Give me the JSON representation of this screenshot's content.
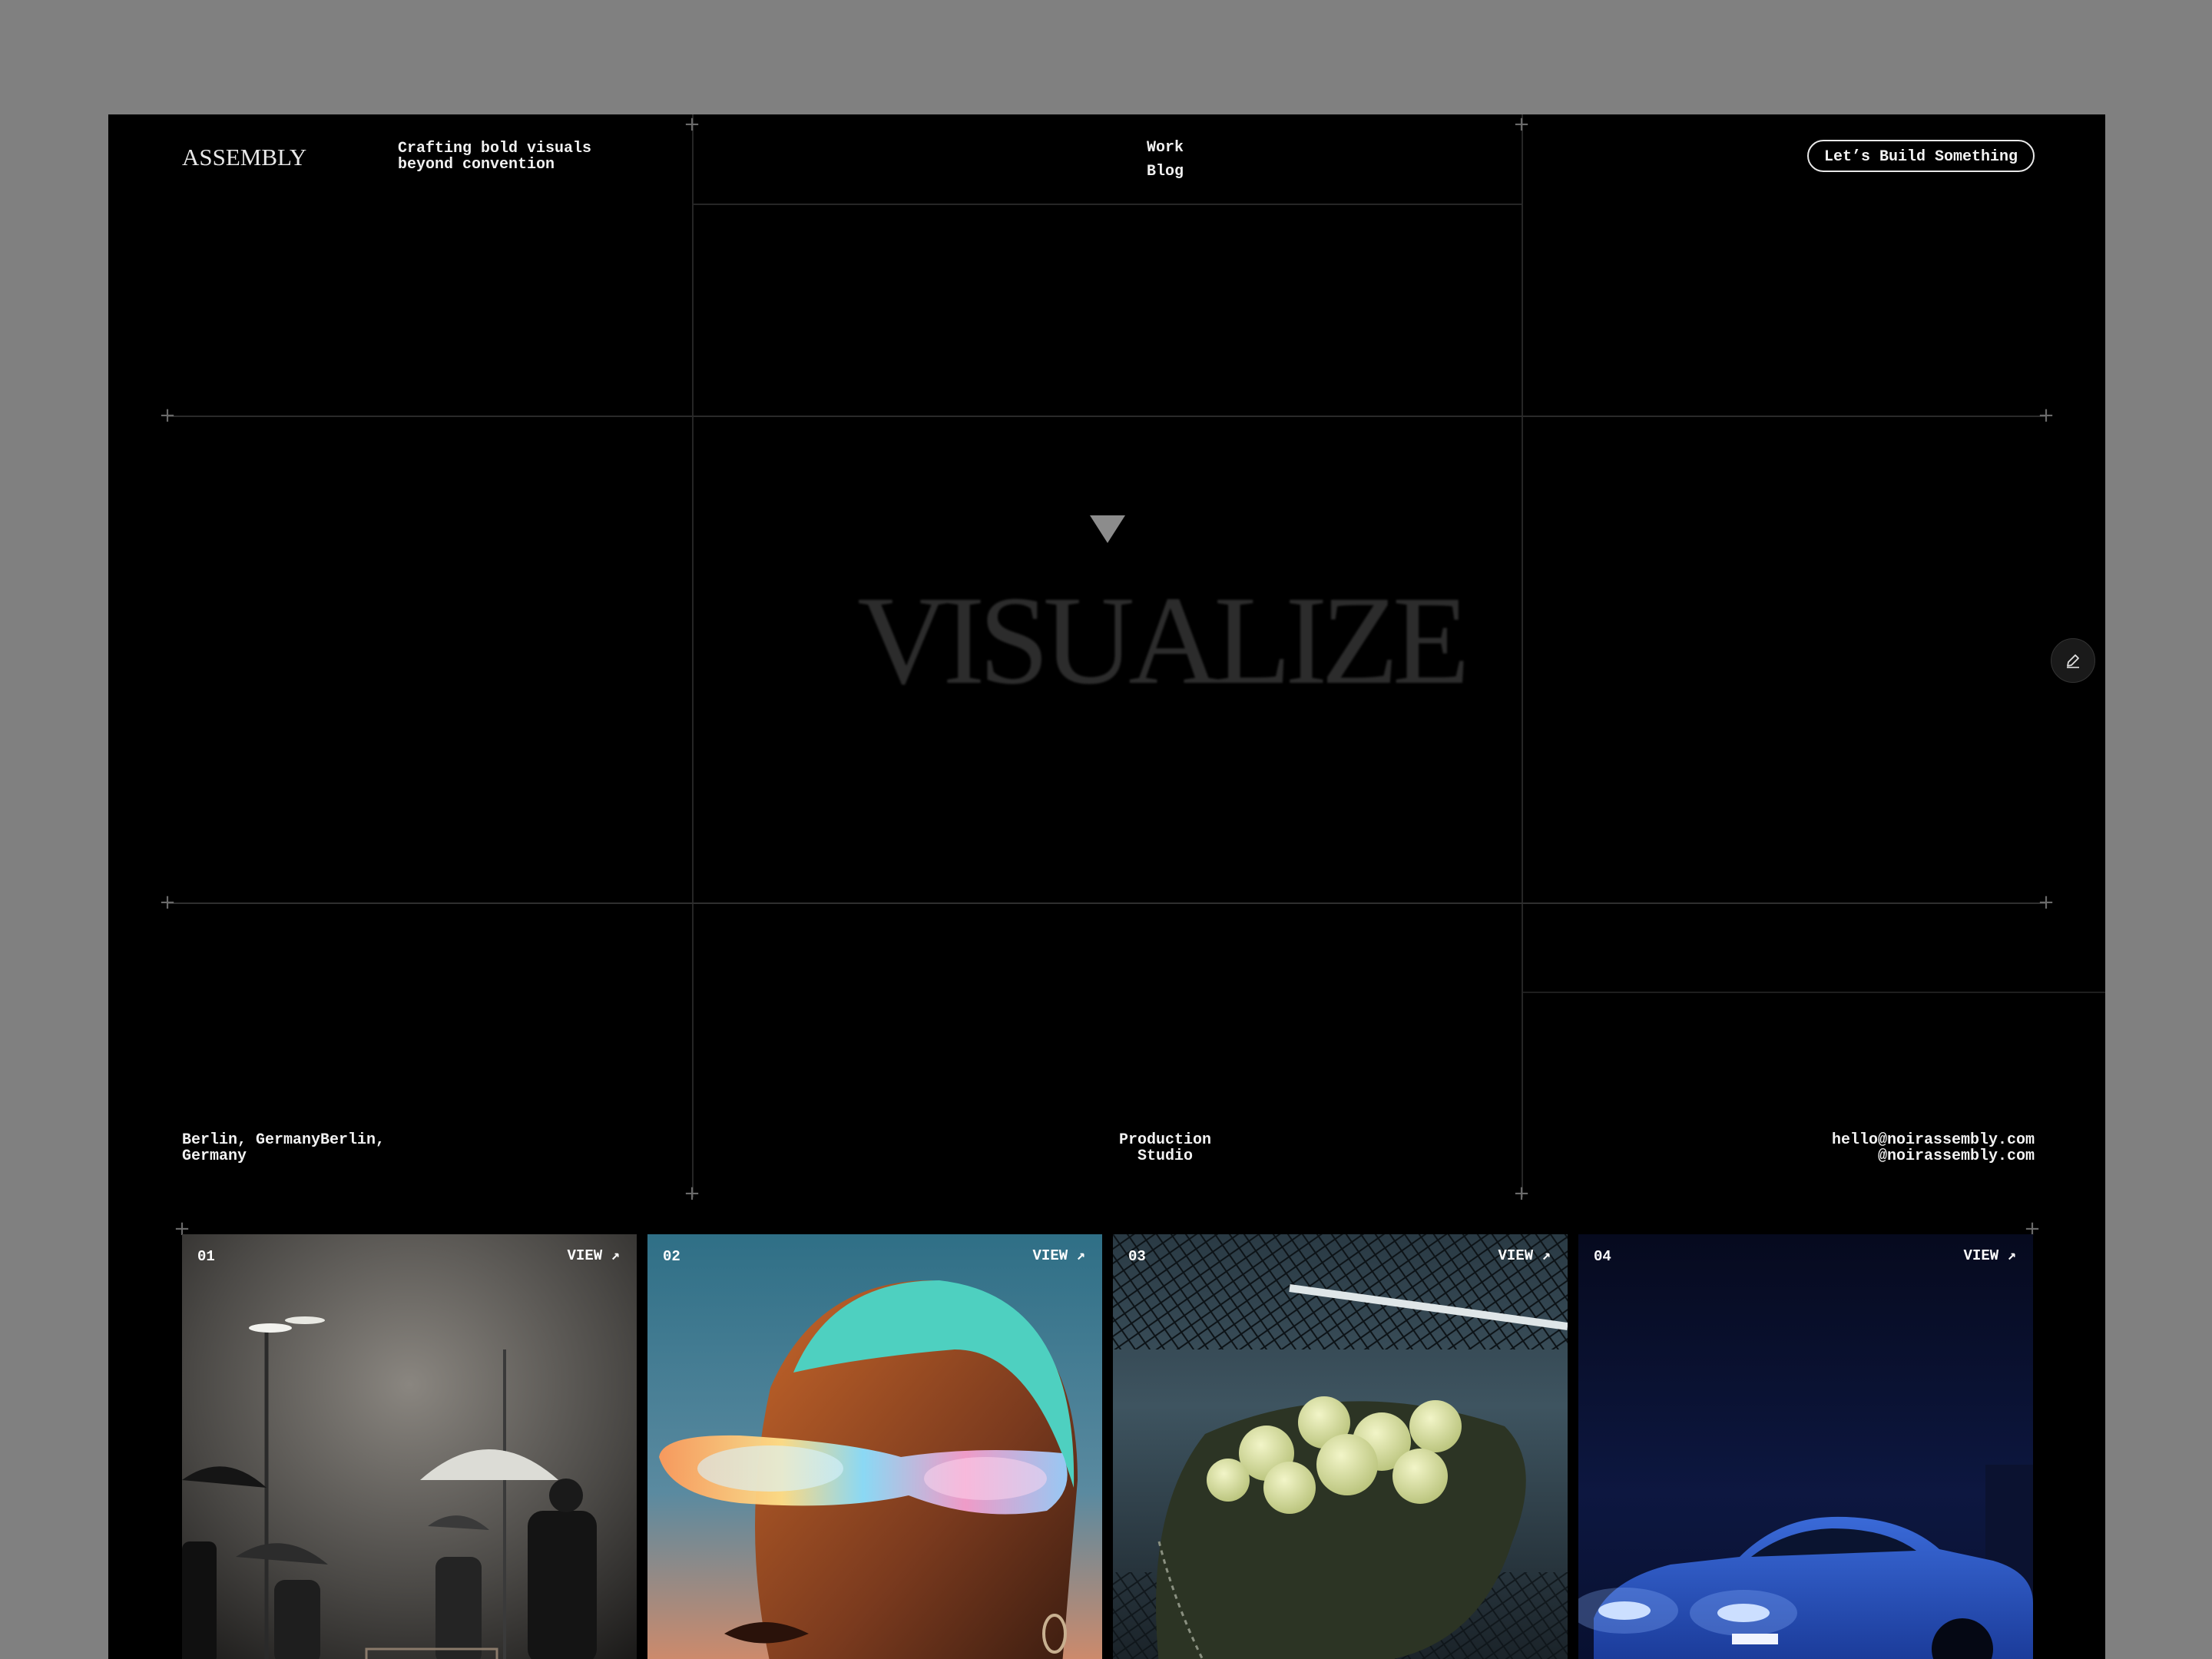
{
  "header": {
    "logo": "ASSEMBLY",
    "tagline_line1": "Crafting bold visuals",
    "tagline_line2": "beyond convention",
    "nav": [
      {
        "label": "Work"
      },
      {
        "label": "Blog"
      }
    ],
    "cta_label": "Let’s Build Something"
  },
  "hero": {
    "word": "VISUALIZE",
    "triangle_icon": "triangle-down-icon"
  },
  "edit_button": {
    "icon": "pen-icon"
  },
  "footer": {
    "location_line1": "Berlin, GermanyBerlin,",
    "location_line2": "Germany",
    "studio_line1": "Production",
    "studio_line2": "Studio",
    "email": "hello@noirassembly.com",
    "handle": "@noirassembly.com"
  },
  "projects": [
    {
      "number": "01",
      "view_label": "VIEW",
      "subject": "people with umbrellas in rain at night"
    },
    {
      "number": "02",
      "view_label": "VIEW",
      "subject": "portrait with iridescent sunglasses"
    },
    {
      "number": "03",
      "view_label": "VIEW",
      "subject": "tennis balls in bag by net"
    },
    {
      "number": "04",
      "view_label": "VIEW",
      "subject": "blue sports car at night"
    }
  ],
  "colors": {
    "page_bg": "#808080",
    "frame_bg": "#000000",
    "text": "#f2f2f2",
    "grid": "#262626"
  }
}
